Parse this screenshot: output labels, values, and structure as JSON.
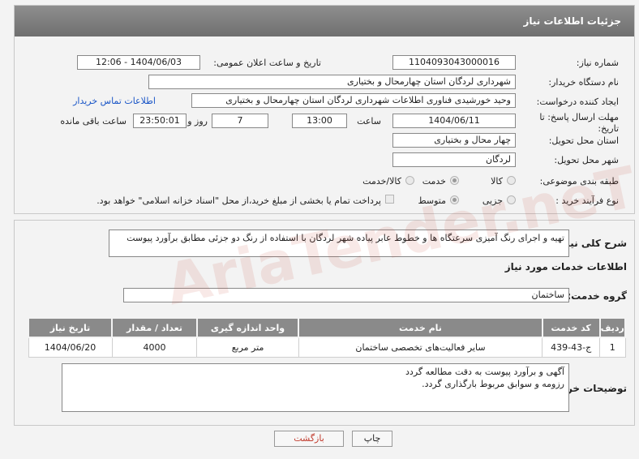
{
  "header": {
    "title": "جزئیات اطلاعات نیاز"
  },
  "fields": {
    "need_number_label": "شماره نیاز:",
    "need_number": "1104093043000016",
    "announce_label": "تاریخ و ساعت اعلان عمومی:",
    "announce_value": "1404/06/03 - 12:06",
    "buyer_org_label": "نام دستگاه خریدار:",
    "buyer_org": "شهرداری لردگان استان چهارمحال و بختیاری",
    "creator_label": "ایجاد کننده درخواست:",
    "creator": "وحید خورشیدی فناوری اطلاعات شهرداری لردگان استان چهارمحال و بختیاری",
    "contact_link": "اطلاعات تماس خریدار",
    "deadline_label": "مهلت ارسال پاسخ: تا تاریخ:",
    "deadline_date": "1404/06/11",
    "time_label": "ساعت",
    "deadline_time": "13:00",
    "days_value": "7",
    "days_label": "روز و",
    "remaining_time": "23:50:01",
    "remaining_label": "ساعت باقی مانده",
    "province_label": "استان محل تحویل:",
    "province": "چهار محال و بختیاری",
    "city_label": "شهر محل تحویل:",
    "city": "لردگان",
    "category_label": "طبقه بندی موضوعی:",
    "category_options": [
      "کالا",
      "خدمت",
      "کالا/خدمت"
    ],
    "process_label": "نوع فرآیند خرید :",
    "process_options": [
      "جزیی",
      "متوسط"
    ],
    "payment_note": "پرداخت تمام یا بخشی از مبلغ خرید،از محل \"اسناد خزانه اسلامی\" خواهد بود."
  },
  "section2": {
    "summary_label": "شرح کلی نیاز:",
    "summary": "تهیه و اجرای رنگ آمیزی سرعتگاه ها و خطوط عابر پیاده شهر لردگان با استفاده از رنگ دو جزئی مطابق برآورد پیوست",
    "services_title": "اطلاعات خدمات مورد نیاز",
    "service_group_label": "گروه خدمت:",
    "service_group": "ساختمان",
    "table": {
      "headers": [
        "ردیف",
        "کد خدمت",
        "نام خدمت",
        "واحد اندازه گیری",
        "تعداد / مقدار",
        "تاریخ نیاز"
      ],
      "rows": [
        [
          "1",
          "ج-43-439",
          "سایر فعالیت‌های تخصصی ساختمان",
          "متر مربع",
          "4000",
          "1404/06/20"
        ]
      ]
    },
    "buyer_notes_label": "توضیحات خریدار:",
    "buyer_notes_line1": "آگهی و برآورد پیوست به دقت مطالعه گردد",
    "buyer_notes_line2": "رزومه و سوابق مربوط بارگذاری گردد."
  },
  "buttons": {
    "print": "چاپ",
    "back": "بازگشت"
  },
  "watermark": "AriaTender.neT"
}
